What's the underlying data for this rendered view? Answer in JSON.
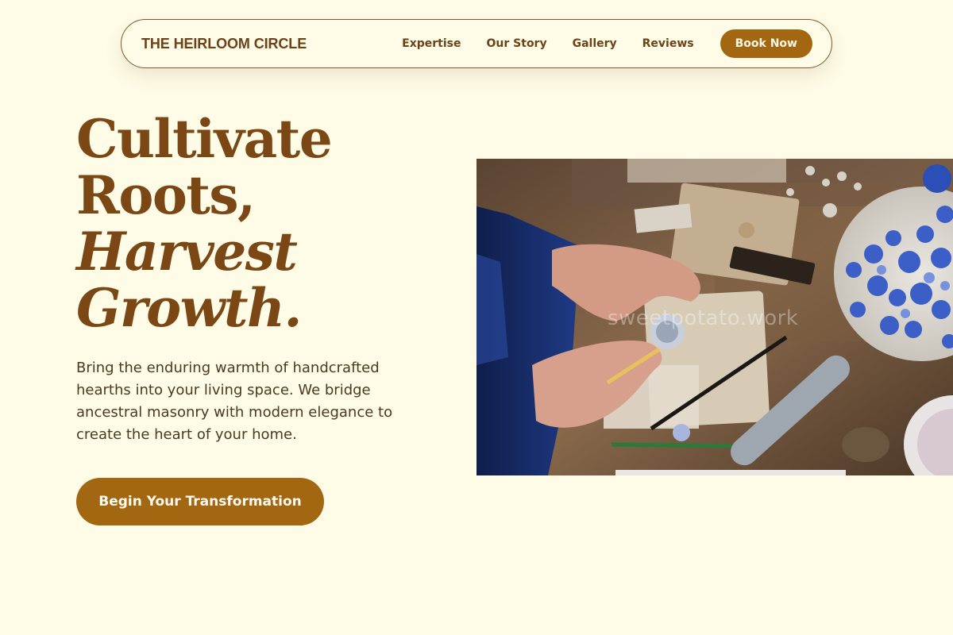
{
  "nav": {
    "brand": "THE HEIRLOOM CIRCLE",
    "links": [
      "Expertise",
      "Our Story",
      "Gallery",
      "Reviews"
    ],
    "book_label": "Book Now"
  },
  "hero": {
    "line1": "Cultivate",
    "line2": "Roots,",
    "line3": "Harvest",
    "line4": "Growth.",
    "description": "Bring the enduring warmth of handcrafted hearths into your living space. We bridge ancestral masonry with modern elegance to create the heart of your home.",
    "cta_label": "Begin Your Transformation"
  },
  "image": {
    "watermark": "sweetpotato.work"
  },
  "colors": {
    "background": "#fefbe6",
    "brand_brown": "#6b4219",
    "accent": "#a36611"
  }
}
